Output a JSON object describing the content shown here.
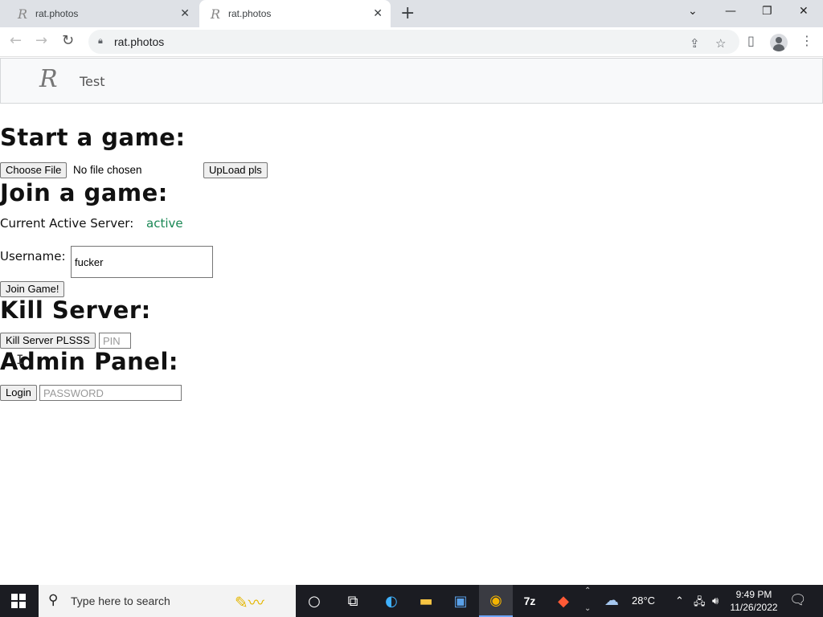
{
  "browser": {
    "tabs": [
      {
        "title": "rat.photos",
        "favicon": "R",
        "active": false
      },
      {
        "title": "rat.photos",
        "favicon": "R",
        "active": true
      }
    ],
    "url": "rat.photos"
  },
  "navbar": {
    "brand": "R",
    "link": "Test"
  },
  "start_game": {
    "heading": "Start a game:",
    "choose_file_label": "Choose File",
    "no_file_text": "No file chosen",
    "upload_label": "UpLoad pls"
  },
  "join_game": {
    "heading": "Join a game:",
    "server_label": "Current Active Server:",
    "server_status": "active",
    "server_status_color": "#198754",
    "username_label": "Username:",
    "username_value": "fucker",
    "join_label": "Join Game!"
  },
  "kill_server": {
    "heading": "Kill Server:",
    "button_label": "Kill Server PLSSS",
    "pin_placeholder": "PIN"
  },
  "admin_panel": {
    "heading": "Admin Panel:",
    "login_label": "Login",
    "password_placeholder": "PASSWORD"
  },
  "taskbar": {
    "search_placeholder": "Type here to search",
    "weather": "28°C",
    "time": "9:49 PM",
    "date": "11/26/2022",
    "apps": [
      "task-view-icon",
      "edge-icon",
      "file-explorer-icon",
      "store-icon",
      "chrome-icon",
      "7zip-icon",
      "brave-icon"
    ]
  }
}
